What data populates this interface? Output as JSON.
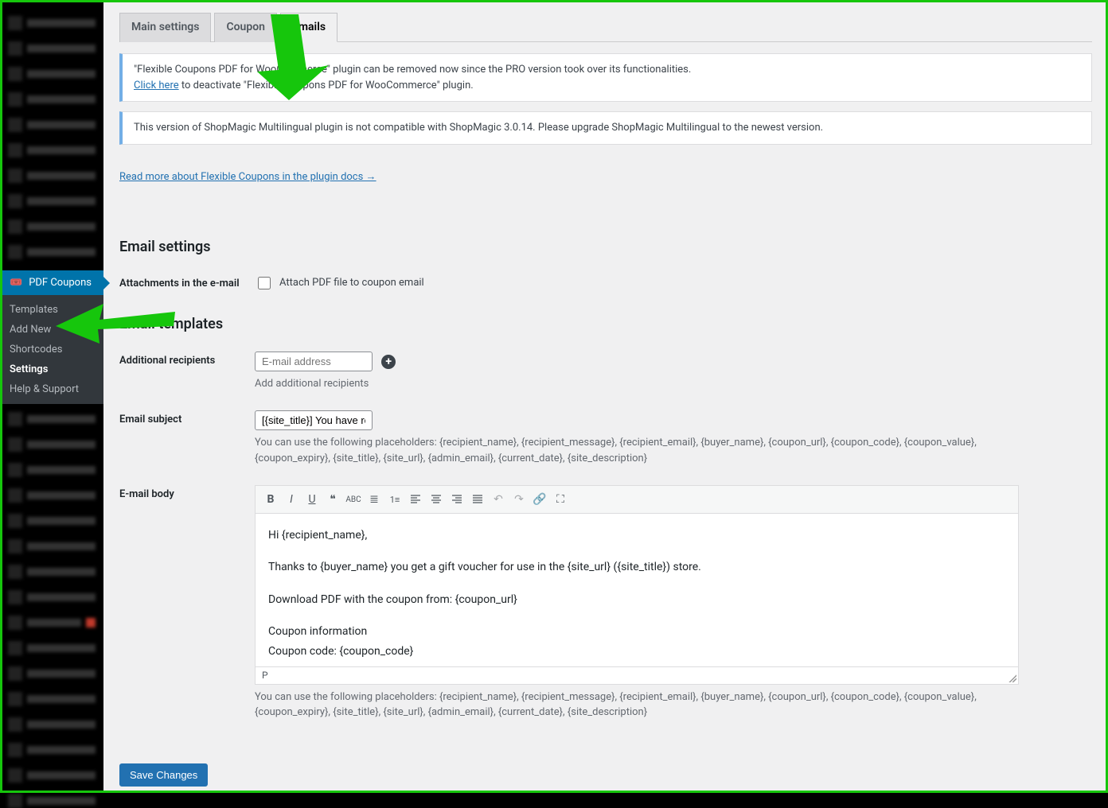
{
  "sidebar": {
    "menu_top": "PDF Coupons",
    "submenu": [
      "Templates",
      "Add New",
      "Shortcodes",
      "Settings",
      "Help & Support"
    ],
    "active_submenu": 3
  },
  "tabs": [
    "Main settings",
    "Coupon",
    "Emails"
  ],
  "active_tab": 2,
  "notice1": {
    "text_a": "\"Flexible Coupons PDF for WooCommerce\" plugin can be removed now since the PRO version took over its functionalities.",
    "link": "Click here",
    "text_b": " to deactivate \"Flexible Coupons PDF for WooCommerce\" plugin."
  },
  "notice2": "This version of ShopMagic Multilingual plugin is not compatible with ShopMagic 3.0.14. Please upgrade ShopMagic Multilingual to the newest version.",
  "docs_link": "Read more about Flexible Coupons in the plugin docs →",
  "section_email_settings": "Email settings",
  "attachments": {
    "label": "Attachments in the e-mail",
    "checkbox_label": "Attach PDF file to coupon email"
  },
  "section_email_templates": "Email templates",
  "recipients": {
    "label": "Additional recipients",
    "placeholder": "E-mail address",
    "desc": "Add additional recipients"
  },
  "subject": {
    "label": "Email subject",
    "value": "[{site_title}] You have recei",
    "desc": "You can use the following placeholders: {recipient_name}, {recipient_message}, {recipient_email}, {buyer_name}, {coupon_url}, {coupon_code}, {coupon_value}, {coupon_expiry}, {site_title}, {site_url}, {admin_email}, {current_date}, {site_description}"
  },
  "body": {
    "label": "E-mail body",
    "lines": [
      "Hi {recipient_name},",
      "Thanks to {buyer_name} you get a gift voucher for use in the {site_url} ({site_title}) store.",
      "Download PDF with the coupon from: {coupon_url}",
      "Coupon information",
      "Coupon code: {coupon_code}"
    ],
    "status": "P",
    "desc": "You can use the following placeholders: {recipient_name}, {recipient_message}, {recipient_email}, {buyer_name}, {coupon_url}, {coupon_code}, {coupon_value}, {coupon_expiry}, {site_title}, {site_url}, {admin_email}, {current_date}, {site_description}"
  },
  "toolbar_icons": [
    "bold",
    "italic",
    "underline",
    "quote",
    "strike",
    "ul",
    "ol",
    "align-left",
    "align-center",
    "align-right",
    "align-justify",
    "undo",
    "redo",
    "link",
    "fullscreen"
  ],
  "save_label": "Save Changes"
}
